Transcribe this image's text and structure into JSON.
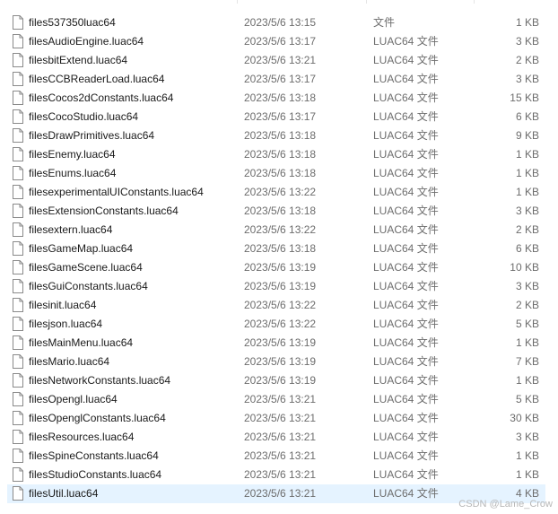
{
  "files": [
    {
      "name": "files537350luac64",
      "date": "2023/5/6 13:15",
      "type": "文件",
      "size": "1 KB"
    },
    {
      "name": "filesAudioEngine.luac64",
      "date": "2023/5/6 13:17",
      "type": "LUAC64 文件",
      "size": "3 KB"
    },
    {
      "name": "filesbitExtend.luac64",
      "date": "2023/5/6 13:21",
      "type": "LUAC64 文件",
      "size": "2 KB"
    },
    {
      "name": "filesCCBReaderLoad.luac64",
      "date": "2023/5/6 13:17",
      "type": "LUAC64 文件",
      "size": "3 KB"
    },
    {
      "name": "filesCocos2dConstants.luac64",
      "date": "2023/5/6 13:18",
      "type": "LUAC64 文件",
      "size": "15 KB"
    },
    {
      "name": "filesCocoStudio.luac64",
      "date": "2023/5/6 13:17",
      "type": "LUAC64 文件",
      "size": "6 KB"
    },
    {
      "name": "filesDrawPrimitives.luac64",
      "date": "2023/5/6 13:18",
      "type": "LUAC64 文件",
      "size": "9 KB"
    },
    {
      "name": "filesEnemy.luac64",
      "date": "2023/5/6 13:18",
      "type": "LUAC64 文件",
      "size": "1 KB"
    },
    {
      "name": "filesEnums.luac64",
      "date": "2023/5/6 13:18",
      "type": "LUAC64 文件",
      "size": "1 KB"
    },
    {
      "name": "filesexperimentalUIConstants.luac64",
      "date": "2023/5/6 13:22",
      "type": "LUAC64 文件",
      "size": "1 KB"
    },
    {
      "name": "filesExtensionConstants.luac64",
      "date": "2023/5/6 13:18",
      "type": "LUAC64 文件",
      "size": "3 KB"
    },
    {
      "name": "filesextern.luac64",
      "date": "2023/5/6 13:22",
      "type": "LUAC64 文件",
      "size": "2 KB"
    },
    {
      "name": "filesGameMap.luac64",
      "date": "2023/5/6 13:18",
      "type": "LUAC64 文件",
      "size": "6 KB"
    },
    {
      "name": "filesGameScene.luac64",
      "date": "2023/5/6 13:19",
      "type": "LUAC64 文件",
      "size": "10 KB"
    },
    {
      "name": "filesGuiConstants.luac64",
      "date": "2023/5/6 13:19",
      "type": "LUAC64 文件",
      "size": "3 KB"
    },
    {
      "name": "filesinit.luac64",
      "date": "2023/5/6 13:22",
      "type": "LUAC64 文件",
      "size": "2 KB"
    },
    {
      "name": "filesjson.luac64",
      "date": "2023/5/6 13:22",
      "type": "LUAC64 文件",
      "size": "5 KB"
    },
    {
      "name": "filesMainMenu.luac64",
      "date": "2023/5/6 13:19",
      "type": "LUAC64 文件",
      "size": "1 KB"
    },
    {
      "name": "filesMario.luac64",
      "date": "2023/5/6 13:19",
      "type": "LUAC64 文件",
      "size": "7 KB"
    },
    {
      "name": "filesNetworkConstants.luac64",
      "date": "2023/5/6 13:19",
      "type": "LUAC64 文件",
      "size": "1 KB"
    },
    {
      "name": "filesOpengl.luac64",
      "date": "2023/5/6 13:21",
      "type": "LUAC64 文件",
      "size": "5 KB"
    },
    {
      "name": "filesOpenglConstants.luac64",
      "date": "2023/5/6 13:21",
      "type": "LUAC64 文件",
      "size": "30 KB"
    },
    {
      "name": "filesResources.luac64",
      "date": "2023/5/6 13:21",
      "type": "LUAC64 文件",
      "size": "3 KB"
    },
    {
      "name": "filesSpineConstants.luac64",
      "date": "2023/5/6 13:21",
      "type": "LUAC64 文件",
      "size": "1 KB"
    },
    {
      "name": "filesStudioConstants.luac64",
      "date": "2023/5/6 13:21",
      "type": "LUAC64 文件",
      "size": "1 KB"
    },
    {
      "name": "filesUtil.luac64",
      "date": "2023/5/6 13:21",
      "type": "LUAC64 文件",
      "size": "4 KB",
      "selected": true
    }
  ],
  "watermark": "CSDN @Lame_Crow",
  "icon": "file-icon",
  "colors": {
    "selected_row": "#e5f3ff",
    "name_text": "#1a1a1a",
    "detail_text": "#6d6d6d"
  }
}
